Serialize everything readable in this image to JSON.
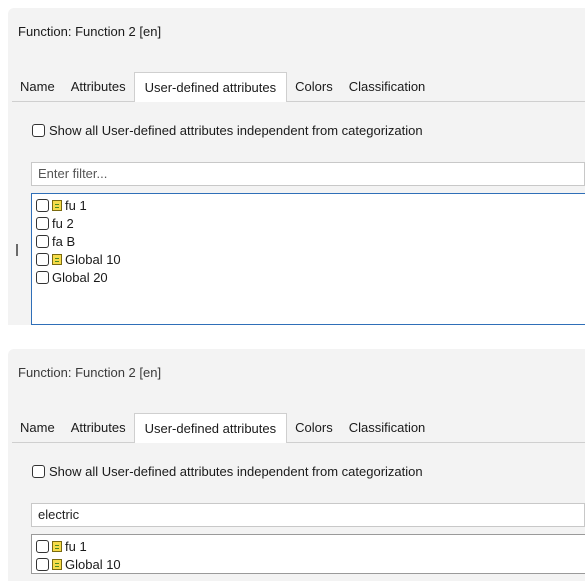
{
  "panels": [
    {
      "title": "Function: Function 2  [en]",
      "tabs": [
        "Name",
        "Attributes",
        "User-defined attributes",
        "Colors",
        "Classification"
      ],
      "active_tab": "User-defined attributes",
      "show_all_label": "Show all User-defined attributes independent from categorization",
      "show_all_checked": false,
      "filter": {
        "value": "",
        "placeholder": "Enter filter..."
      },
      "items": [
        {
          "label": "fu 1",
          "checked": false,
          "icon": "attribute-icon"
        },
        {
          "label": "fu 2",
          "checked": false,
          "icon": null
        },
        {
          "label": "fa B",
          "checked": false,
          "icon": null
        },
        {
          "label": "Global 10",
          "checked": false,
          "icon": "attribute-icon"
        },
        {
          "label": "Global 20",
          "checked": false,
          "icon": null
        }
      ]
    },
    {
      "title": "Function: Function 2  [en]",
      "tabs": [
        "Name",
        "Attributes",
        "User-defined attributes",
        "Colors",
        "Classification"
      ],
      "active_tab": "User-defined attributes",
      "show_all_label": "Show all User-defined attributes independent from categorization",
      "show_all_checked": false,
      "filter": {
        "value": "electric",
        "placeholder": "Enter filter..."
      },
      "items": [
        {
          "label": "fu 1",
          "checked": false,
          "icon": "attribute-icon"
        },
        {
          "label": "Global 10",
          "checked": false,
          "icon": "attribute-icon"
        }
      ]
    }
  ],
  "colors": {
    "accent_border": "#2f6fb8",
    "attr_icon": "#f6dc4a"
  }
}
